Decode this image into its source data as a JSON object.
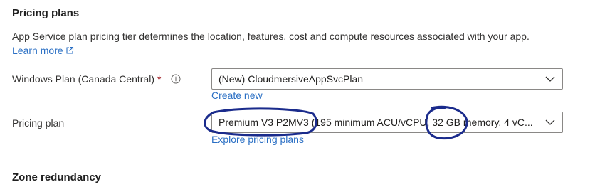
{
  "section": {
    "title": "Pricing plans",
    "description": "App Service plan pricing tier determines the location, features, cost and compute resources associated with your app.",
    "learn_more": "Learn more",
    "learn_more_icon": "external-link-icon"
  },
  "windows_plan": {
    "label": "Windows Plan (Canada Central)",
    "required_mark": "*",
    "value": "(New) CloudmersiveAppSvcPlan",
    "create_new": "Create new"
  },
  "pricing_plan": {
    "label": "Pricing plan",
    "value": "Premium V3 P2MV3 (195 minimum ACU/vCPU, 32 GB memory, 4 vC...",
    "explore": "Explore pricing plans"
  },
  "zone": {
    "title": "Zone redundancy"
  },
  "colors": {
    "link": "#2a6fc4",
    "annotation": "#1a2b8c",
    "required": "#a4262c"
  }
}
